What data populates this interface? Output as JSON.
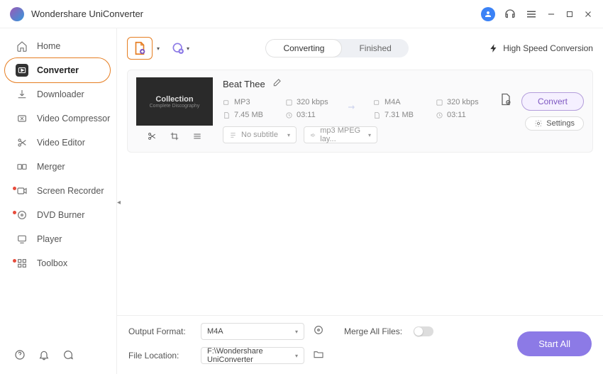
{
  "app": {
    "title": "Wondershare UniConverter"
  },
  "sidebar": {
    "items": [
      {
        "label": "Home"
      },
      {
        "label": "Converter"
      },
      {
        "label": "Downloader"
      },
      {
        "label": "Video Compressor"
      },
      {
        "label": "Video Editor"
      },
      {
        "label": "Merger"
      },
      {
        "label": "Screen Recorder"
      },
      {
        "label": "DVD Burner"
      },
      {
        "label": "Player"
      },
      {
        "label": "Toolbox"
      }
    ]
  },
  "tabs": {
    "converting": "Converting",
    "finished": "Finished"
  },
  "toolbar": {
    "high_speed": "High Speed Conversion"
  },
  "file": {
    "title": "Beat Thee",
    "thumb_line1": "Collection",
    "thumb_line2": "Complete Discography",
    "src": {
      "format": "MP3",
      "bitrate": "320 kbps",
      "size": "7.45 MB",
      "duration": "03:11"
    },
    "dst": {
      "format": "M4A",
      "bitrate": "320 kbps",
      "size": "7.31 MB",
      "duration": "03:11"
    },
    "subtitle": "No subtitle",
    "audio_codec": "mp3 MPEG lay...",
    "settings_label": "Settings",
    "convert_label": "Convert"
  },
  "footer": {
    "output_format_label": "Output Format:",
    "output_format_value": "M4A",
    "file_location_label": "File Location:",
    "file_location_value": "F:\\Wondershare UniConverter",
    "merge_label": "Merge All Files:",
    "start_all": "Start All"
  }
}
